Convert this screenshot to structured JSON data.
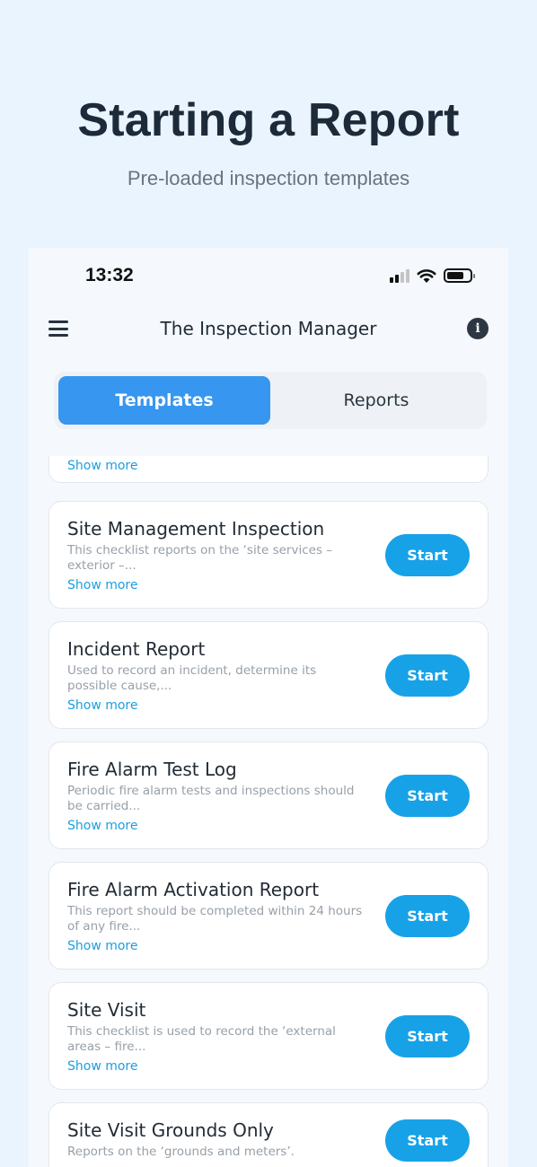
{
  "hero": {
    "title": "Starting a Report",
    "subtitle": "Pre-loaded inspection templates"
  },
  "status_bar": {
    "time": "13:32"
  },
  "app_bar": {
    "title": "The Inspection Manager",
    "menu_icon": "hamburger-menu-icon",
    "info_icon": "info-icon"
  },
  "tabs": [
    {
      "label": "Templates",
      "active": true
    },
    {
      "label": "Reports",
      "active": false
    }
  ],
  "partial_card": {
    "show_more": "Show more"
  },
  "templates": [
    {
      "title": "Site Management Inspection",
      "description": "This checklist reports on the ‘site services – exterior –...",
      "show_more": "Show more",
      "action": "Start"
    },
    {
      "title": "Incident Report",
      "description": "Used to record an incident, determine its possible cause,...",
      "show_more": "Show more",
      "action": "Start"
    },
    {
      "title": "Fire Alarm Test Log",
      "description": "Periodic fire alarm tests and inspections should be carried...",
      "show_more": "Show more",
      "action": "Start"
    },
    {
      "title": "Fire Alarm Activation Report",
      "description": "This report should be completed within 24 hours of any fire...",
      "show_more": "Show more",
      "action": "Start"
    },
    {
      "title": "Site Visit",
      "description": "This checklist is used to record the ‘external areas – fire...",
      "show_more": "Show more",
      "action": "Start"
    },
    {
      "title": "Site Visit Grounds Only",
      "description": "Reports on the ‘grounds and meters’.",
      "show_more": "",
      "action": "Start"
    }
  ],
  "colors": {
    "background": "#eaf4fe",
    "accent_tab": "#3796ef",
    "start_button": "#17a2e8",
    "link": "#1c9ee0"
  }
}
